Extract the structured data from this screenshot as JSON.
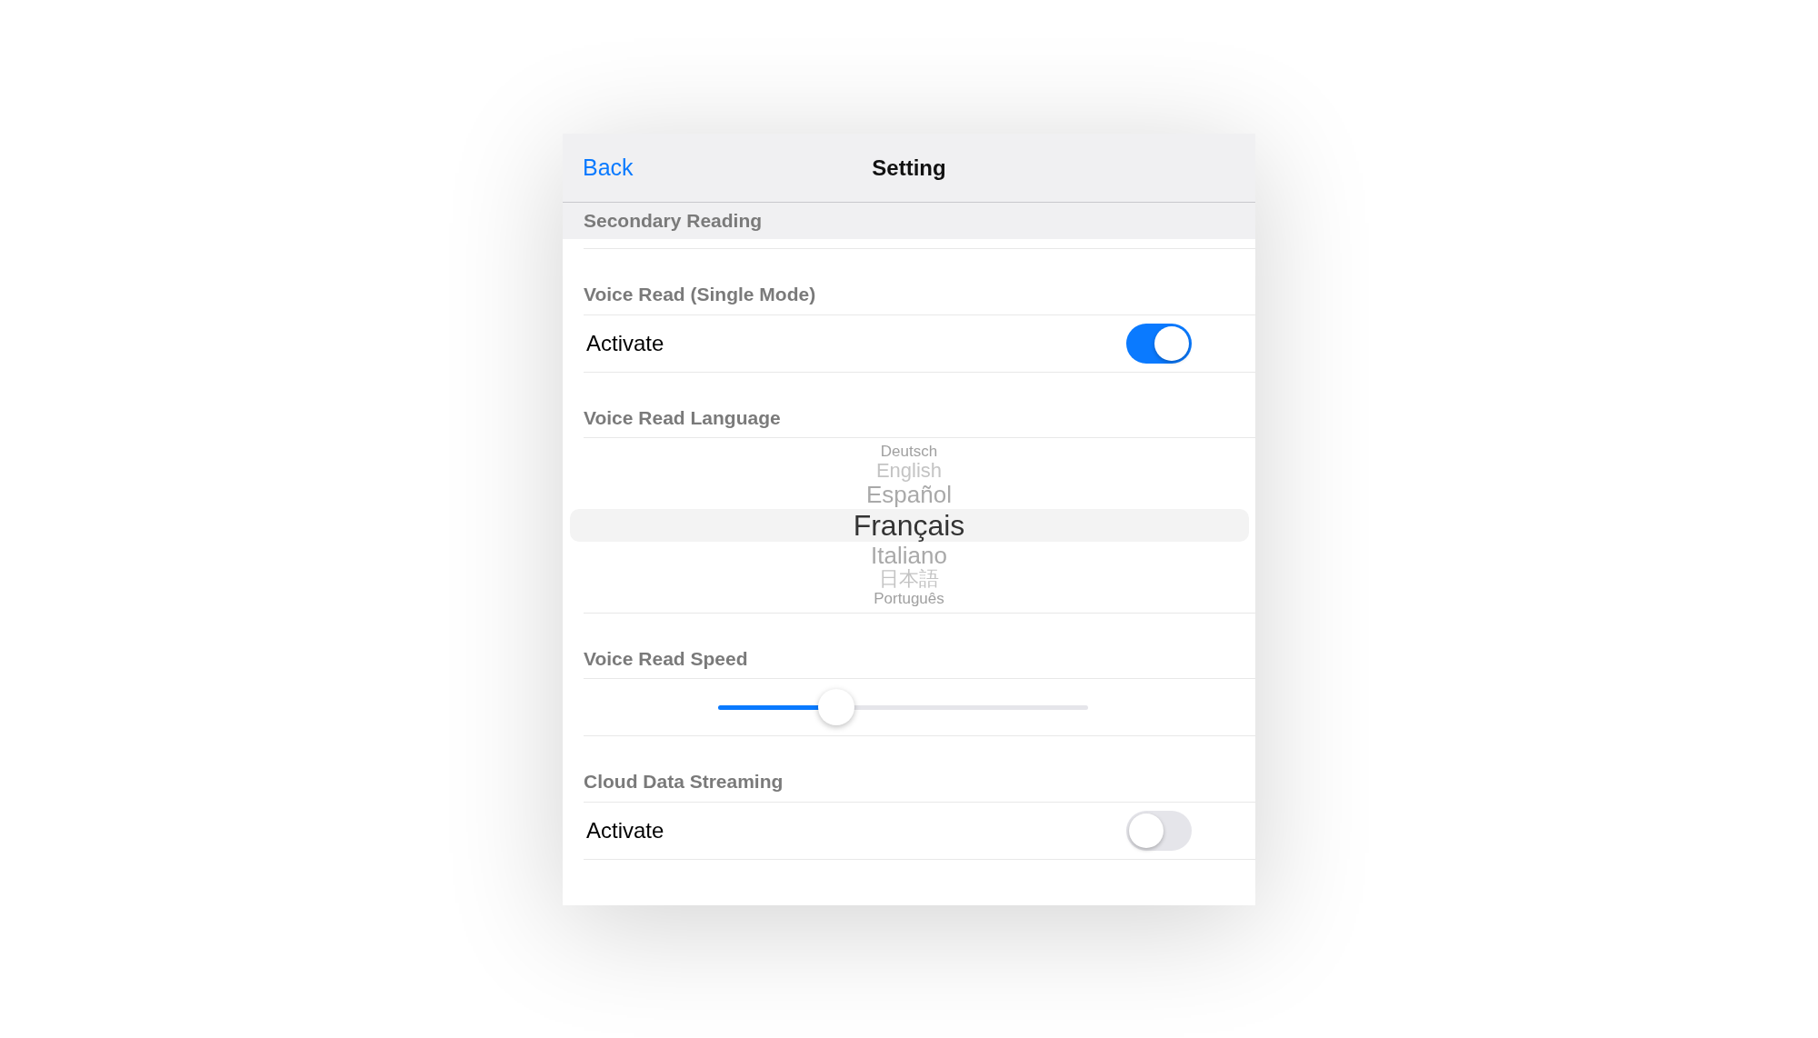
{
  "nav": {
    "back": "Back",
    "title": "Setting"
  },
  "section": "Secondary Reading",
  "groups": [
    {
      "kind": "toggle",
      "header": "Voice Read (Single Mode)",
      "label": "Activate",
      "on": true
    },
    {
      "kind": "picker",
      "header": "Voice Read Language",
      "options": [
        {
          "label": "Deutsch",
          "selected": false
        },
        {
          "label": "English",
          "selected": false
        },
        {
          "label": "Español",
          "selected": false
        },
        {
          "label": "Français",
          "selected": true
        },
        {
          "label": "Italiano",
          "selected": false
        },
        {
          "label": "日本語",
          "selected": false
        },
        {
          "label": "Português",
          "selected": false
        }
      ]
    },
    {
      "kind": "slider",
      "header": "Voice Read Speed",
      "level": 0.32
    },
    {
      "kind": "toggle",
      "header": "Cloud Data Streaming",
      "label": "Activate",
      "on": false
    }
  ]
}
